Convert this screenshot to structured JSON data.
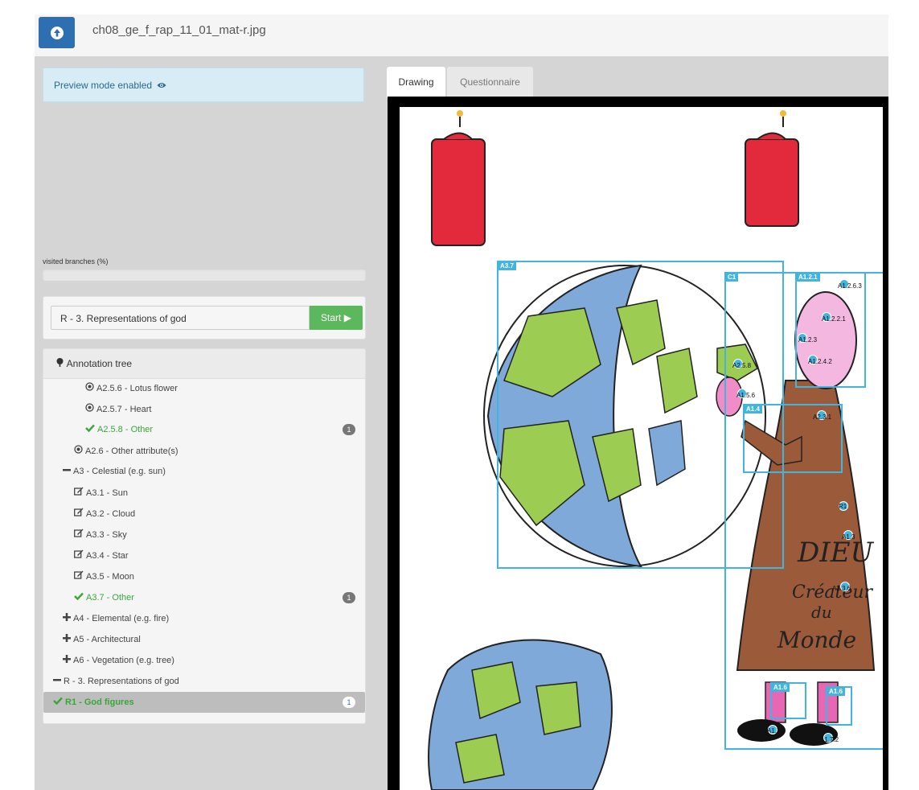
{
  "header": {
    "filename": "ch08_ge_f_rap_11_01_mat-r.jpg",
    "upload_icon": "arrow-up-circle-icon"
  },
  "preview": {
    "text": "Preview mode enabled",
    "icon": "eye-icon"
  },
  "visited": {
    "label": "visited branches (%)",
    "value_percent": 0
  },
  "start": {
    "select_value": "R - 3. Representations of god",
    "button_label": "Start ▶"
  },
  "tree": {
    "title": "Annotation tree",
    "items": [
      {
        "label": "A2.5.6 - Lotus flower",
        "icon": "radio-icon",
        "state": "plain"
      },
      {
        "label": "A2.5.7 - Heart",
        "icon": "radio-icon",
        "state": "plain"
      },
      {
        "label": "A2.5.8 - Other",
        "icon": "check-icon",
        "state": "done",
        "count": "1"
      },
      {
        "label": "A2.6 - Other attribute(s)",
        "icon": "radio-icon",
        "state": "plain"
      },
      {
        "label": "A3 - Celestial (e.g. sun)",
        "icon": "minus-icon",
        "state": "plain"
      },
      {
        "label": "A3.1 - Sun",
        "icon": "edit-icon",
        "state": "plain"
      },
      {
        "label": "A3.2 - Cloud",
        "icon": "edit-icon",
        "state": "plain"
      },
      {
        "label": "A3.3 - Sky",
        "icon": "edit-icon",
        "state": "plain"
      },
      {
        "label": "A3.4 - Star",
        "icon": "edit-icon",
        "state": "plain"
      },
      {
        "label": "A3.5 - Moon",
        "icon": "edit-icon",
        "state": "plain"
      },
      {
        "label": "A3.7 - Other",
        "icon": "check-icon",
        "state": "done",
        "count": "1"
      },
      {
        "label": "A4 - Elemental (e.g. fire)",
        "icon": "plus-icon",
        "state": "plain"
      },
      {
        "label": "A5 - Architectural",
        "icon": "plus-icon",
        "state": "plain"
      },
      {
        "label": "A6 - Vegetation (e.g. tree)",
        "icon": "plus-icon",
        "state": "plain"
      },
      {
        "label": "R - 3. Representations of god",
        "icon": "minus-icon",
        "state": "plain"
      },
      {
        "label": "R1 - God figures",
        "icon": "check-icon",
        "state": "selected",
        "count": "1"
      }
    ]
  },
  "tabs": [
    {
      "label": "Drawing",
      "active": true
    },
    {
      "label": "Questionnaire",
      "active": false
    }
  ],
  "drawing": {
    "boxes": [
      "A3.7",
      "C1",
      "A1.2.1",
      "A1.4",
      "A1.6",
      "A1.6"
    ],
    "points": [
      "A1.2.6.3",
      "A1.2.2.1",
      "A1.2.3",
      "A1.2.4.2",
      "A2.5.8",
      "A1.5.6",
      "A2.3.1",
      "R1",
      "A1.3",
      "A2.3.6",
      "A1.7",
      "A1.7.2"
    ],
    "text_on_drawing": "DIEU Créateur du Monde",
    "accent": "#43b4dd"
  }
}
